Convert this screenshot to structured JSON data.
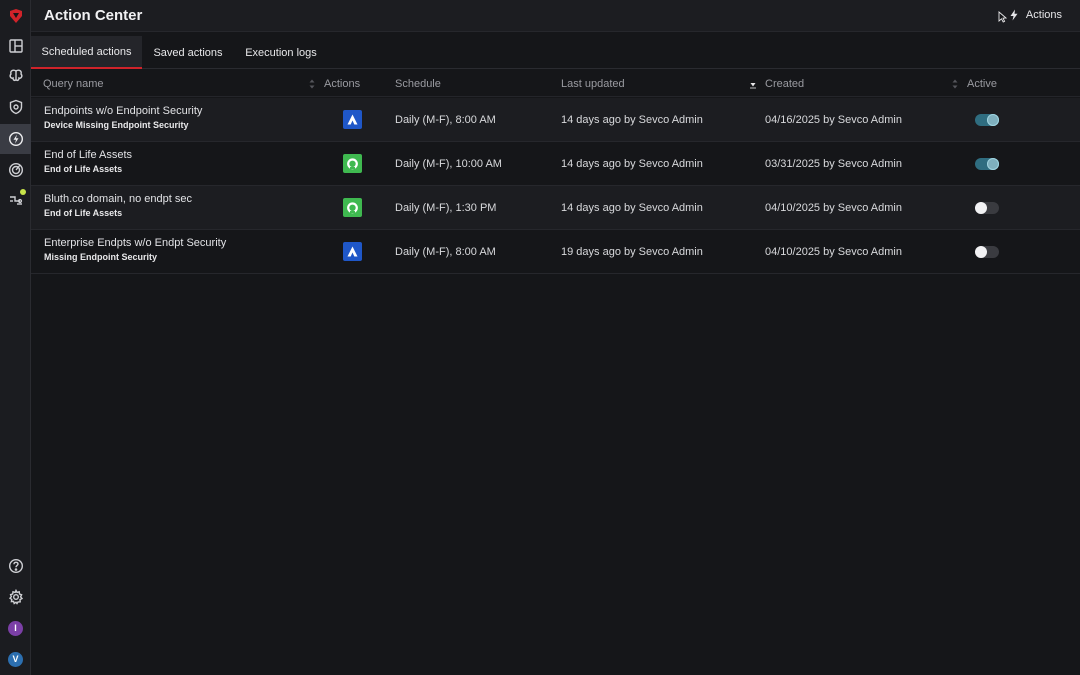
{
  "header": {
    "title": "Action Center",
    "actions_label": "Actions"
  },
  "tabs": [
    {
      "label": "Scheduled actions",
      "active": true
    },
    {
      "label": "Saved actions",
      "active": false
    },
    {
      "label": "Execution logs",
      "active": false
    }
  ],
  "table": {
    "columns": [
      "Query name",
      "Actions",
      "Schedule",
      "Last updated",
      "Created",
      "Active"
    ],
    "sort_column": "Last updated",
    "rows": [
      {
        "query": "Endpoints w/o Endpoint Security",
        "subtitle": "Device Missing Endpoint Security",
        "action_icon": "atlassian-icon",
        "schedule": "Daily (M-F), 8:00 AM",
        "last_updated": "14 days ago by Sevco Admin",
        "created": "04/16/2025 by Sevco Admin",
        "active": true
      },
      {
        "query": "End of Life Assets",
        "subtitle": "End of Life Assets",
        "action_icon": "servicenow-icon",
        "schedule": "Daily (M-F), 10:00 AM",
        "last_updated": "14 days ago by Sevco Admin",
        "created": "03/31/2025 by Sevco Admin",
        "active": true
      },
      {
        "query": "Bluth.co domain, no endpt sec",
        "subtitle": "End of Life Assets",
        "action_icon": "servicenow-icon",
        "schedule": "Daily (M-F), 1:30 PM",
        "last_updated": "14 days ago by Sevco Admin",
        "created": "04/10/2025 by Sevco Admin",
        "active": false
      },
      {
        "query": "Enterprise Endpts w/o Endpt Security",
        "subtitle": "Missing Endpoint Security",
        "action_icon": "atlassian-icon",
        "schedule": "Daily (M-F), 8:00 AM",
        "last_updated": "19 days ago by Sevco Admin",
        "created": "04/10/2025 by Sevco Admin",
        "active": false
      }
    ]
  },
  "sidebar": {
    "top_icons": [
      "logo-icon",
      "dashboard-icon",
      "brain-icon",
      "shield-icon",
      "lightning-icon",
      "radar-icon",
      "integrations-icon"
    ],
    "bottom_icons": [
      "help-icon",
      "gear-icon"
    ],
    "avatars": [
      {
        "initial": "I",
        "color": "#7b3fa6"
      },
      {
        "initial": "V",
        "color": "#2c6fb0"
      }
    ]
  },
  "colors": {
    "accent": "#d0232a",
    "atlassian": "#1f57c8",
    "servicenow": "#3fb950",
    "toggle_on": "#2f6d80"
  }
}
